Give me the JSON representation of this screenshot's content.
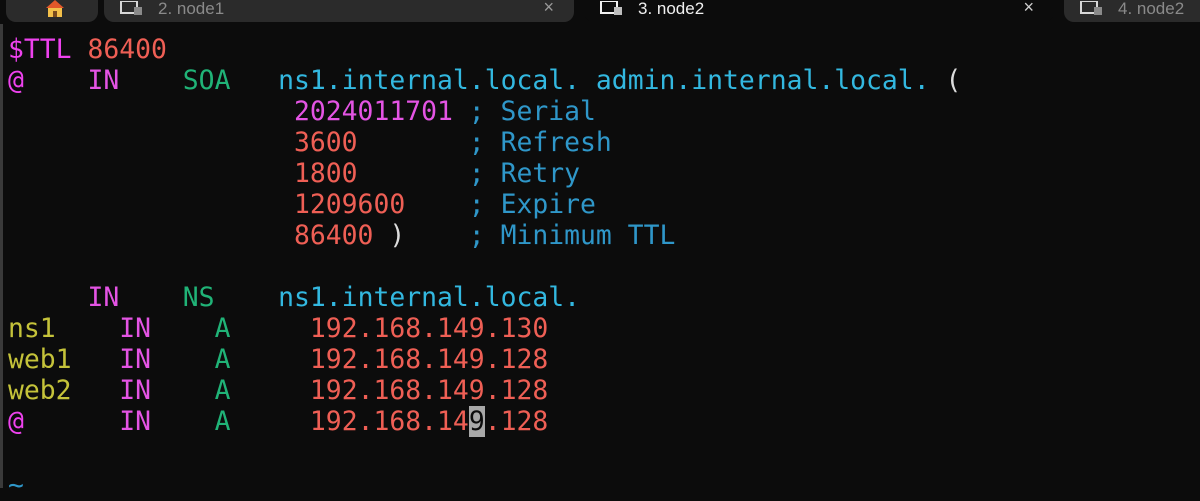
{
  "tabs": [
    {
      "label": ""
    },
    {
      "label": "2. node1",
      "close": "×"
    },
    {
      "label": "3. node2",
      "close": "×"
    },
    {
      "label": "4. node2"
    }
  ],
  "zone": {
    "l1_a": "$TTL",
    "l1_b": "86400",
    "l2_at": "@",
    "l2_in": "IN",
    "l2_soa": "SOA",
    "l2_ns": "ns1.internal.local.",
    "l2_admin": "admin.internal.local.",
    "l2_paren": "(",
    "serial": "2024011701",
    "serial_c": "; Serial",
    "refresh": "3600",
    "refresh_c": "; Refresh",
    "retry": "1800",
    "retry_c": "; Retry",
    "expire": "1209600",
    "expire_c": "; Expire",
    "minimum": "86400",
    "minimum_paren": ")",
    "minimum_c": "; Minimum TTL",
    "ns_in": "IN",
    "ns_type": "NS",
    "ns_val": "ns1.internal.local.",
    "r1_name": "ns1",
    "r1_in": "IN",
    "r1_type": "A",
    "r1_ip": "192.168.149.130",
    "r2_name": "web1",
    "r2_in": "IN",
    "r2_type": "A",
    "r2_ip": "192.168.149.128",
    "r3_name": "web2",
    "r3_in": "IN",
    "r3_type": "A",
    "r3_ip": "192.168.149.128",
    "r4_name": "@",
    "r4_in": "IN",
    "r4_type": "A",
    "r4_ip_a": "192.168.14",
    "r4_ip_cursor": "9",
    "r4_ip_b": ".128",
    "tilde": "~"
  }
}
